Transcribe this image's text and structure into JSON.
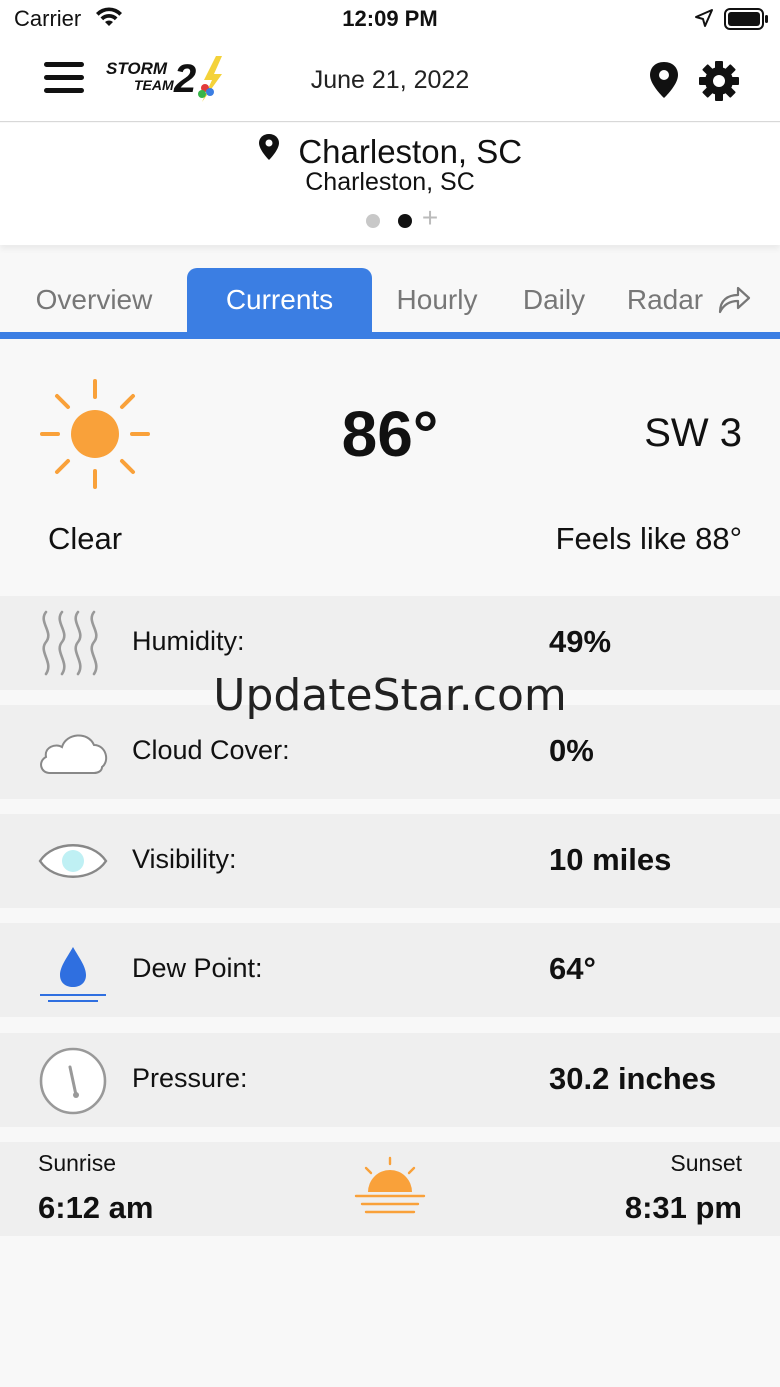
{
  "status_bar": {
    "carrier": "Carrier",
    "time": "12:09 PM"
  },
  "header": {
    "date": "June 21, 2022",
    "logo_text_line1": "STORM",
    "logo_text_line2": "TEAM",
    "logo_number": "2"
  },
  "location": {
    "city": "Charleston, SC",
    "subtitle": "Charleston, SC",
    "add_symbol": "+"
  },
  "tabs": [
    {
      "label": "Overview"
    },
    {
      "label": "Currents"
    },
    {
      "label": "Hourly"
    },
    {
      "label": "Daily"
    },
    {
      "label": "Radar"
    }
  ],
  "current": {
    "temperature": "86°",
    "wind": "SW 3",
    "condition": "Clear",
    "feels_like": "Feels like 88°"
  },
  "details": [
    {
      "label": "Humidity:",
      "value": "49%",
      "icon": "humidity-icon"
    },
    {
      "label": "Cloud Cover:",
      "value": "0%",
      "icon": "cloud-icon"
    },
    {
      "label": "Visibility:",
      "value": "10 miles",
      "icon": "eye-icon"
    },
    {
      "label": "Dew Point:",
      "value": "64°",
      "icon": "water-drop-icon"
    },
    {
      "label": "Pressure:",
      "value": "30.2 inches",
      "icon": "gauge-icon"
    }
  ],
  "sun": {
    "sunrise_label": "Sunrise",
    "sunrise_time": "6:12 am",
    "sunset_label": "Sunset",
    "sunset_time": "8:31 pm"
  },
  "watermark": "UpdateStar.com",
  "colors": {
    "accent": "#3b7ee3",
    "sun": "#f9a13a",
    "drop": "#2f6fe0",
    "eye": "#bff0f4"
  }
}
